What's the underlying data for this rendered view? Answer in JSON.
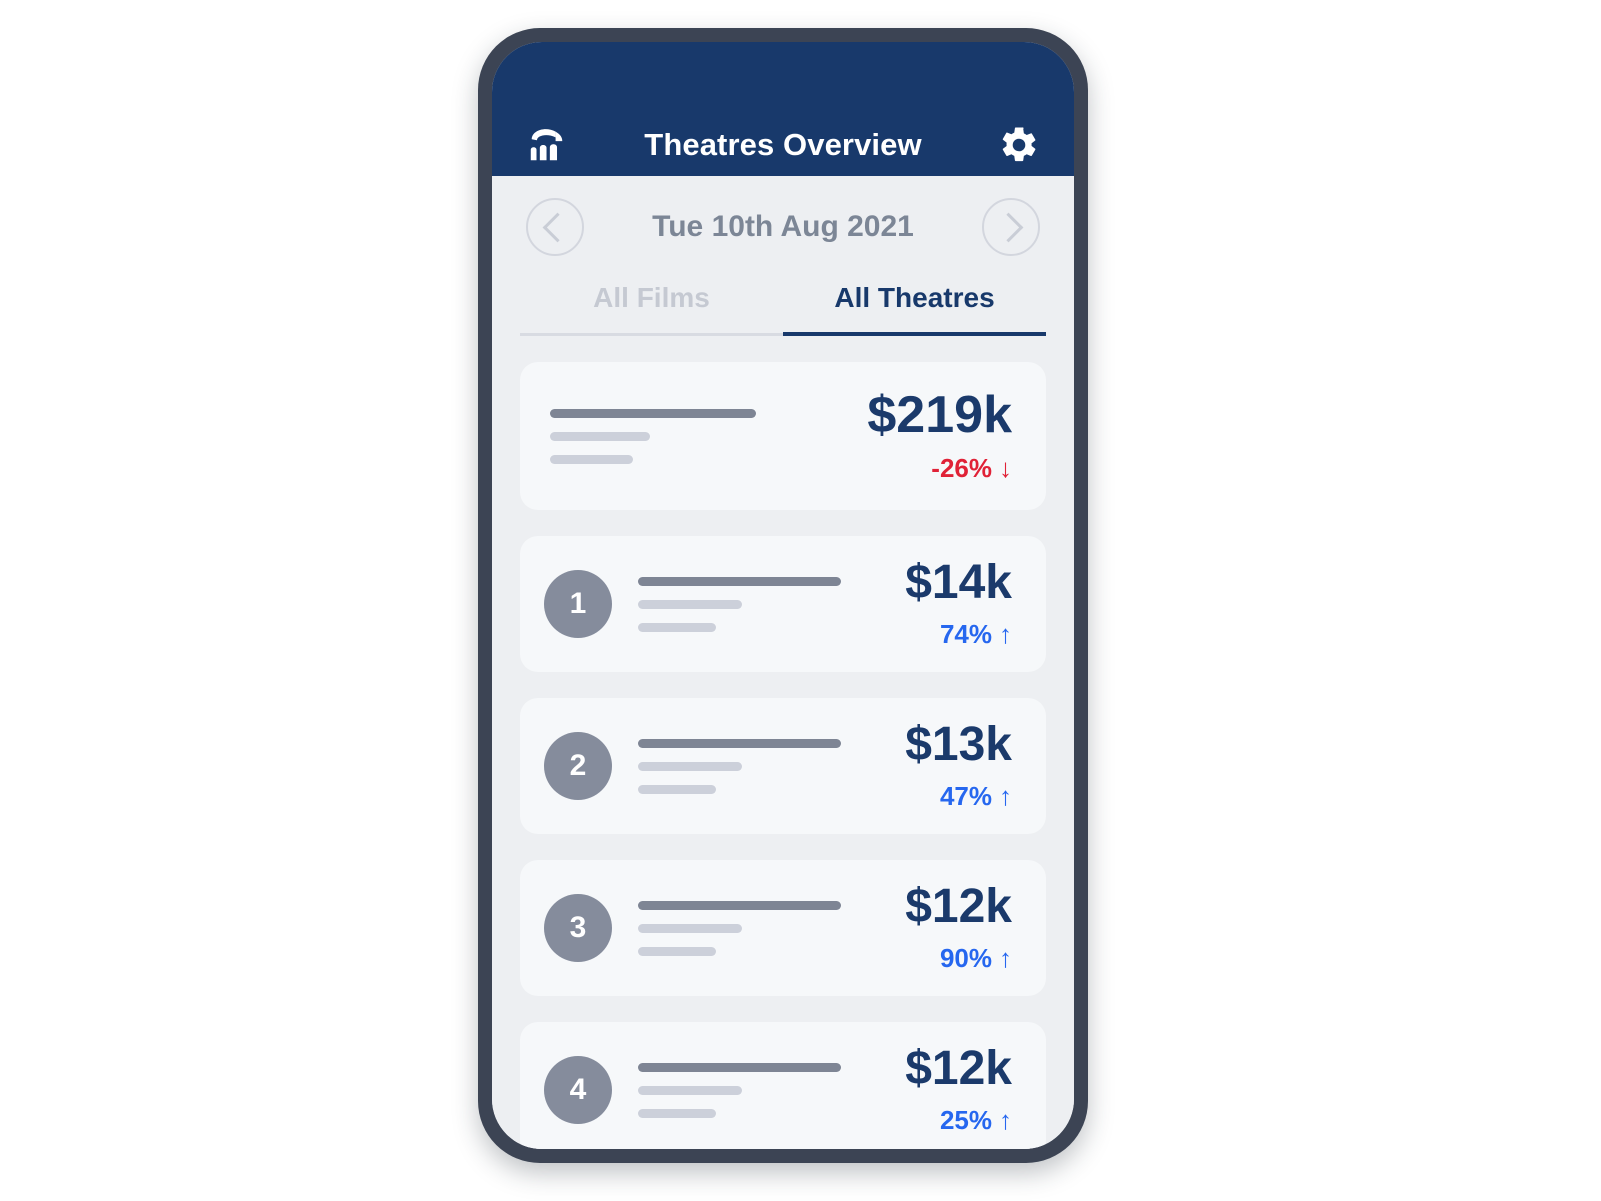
{
  "app": {
    "title": "Theatres Overview",
    "logo_icon": "theatre-arches-logo-icon",
    "settings_icon": "gear-icon",
    "header_bg": "#18396b"
  },
  "datebar": {
    "prev_icon": "chevron-left-icon",
    "next_icon": "chevron-right-icon",
    "date": "Tue 10th Aug 2021"
  },
  "tabs": [
    {
      "label": "All Films",
      "active": false
    },
    {
      "label": "All Theatres",
      "active": true
    }
  ],
  "summary": {
    "value": "$219k",
    "delta": "-26%",
    "delta_direction": "down",
    "delta_arrow": "↓",
    "delta_color": "#e02237"
  },
  "rankings": [
    {
      "rank": "1",
      "value": "$14k",
      "delta": "74%",
      "delta_direction": "up",
      "delta_arrow": "↑",
      "delta_color": "#2667ef"
    },
    {
      "rank": "2",
      "value": "$13k",
      "delta": "47%",
      "delta_direction": "up",
      "delta_arrow": "↑",
      "delta_color": "#2667ef"
    },
    {
      "rank": "3",
      "value": "$12k",
      "delta": "90%",
      "delta_direction": "up",
      "delta_arrow": "↑",
      "delta_color": "#2667ef"
    },
    {
      "rank": "4",
      "value": "$12k",
      "delta": "25%",
      "delta_direction": "up",
      "delta_arrow": "↑",
      "delta_color": "#2667ef"
    }
  ],
  "theme": {
    "brand_navy": "#18396b",
    "page_bg": "#edeff2",
    "card_bg": "#f6f8fa",
    "device_frame": "#3c4454",
    "rank_badge_bg": "#858c9c",
    "muted_text": "#7c8696"
  }
}
